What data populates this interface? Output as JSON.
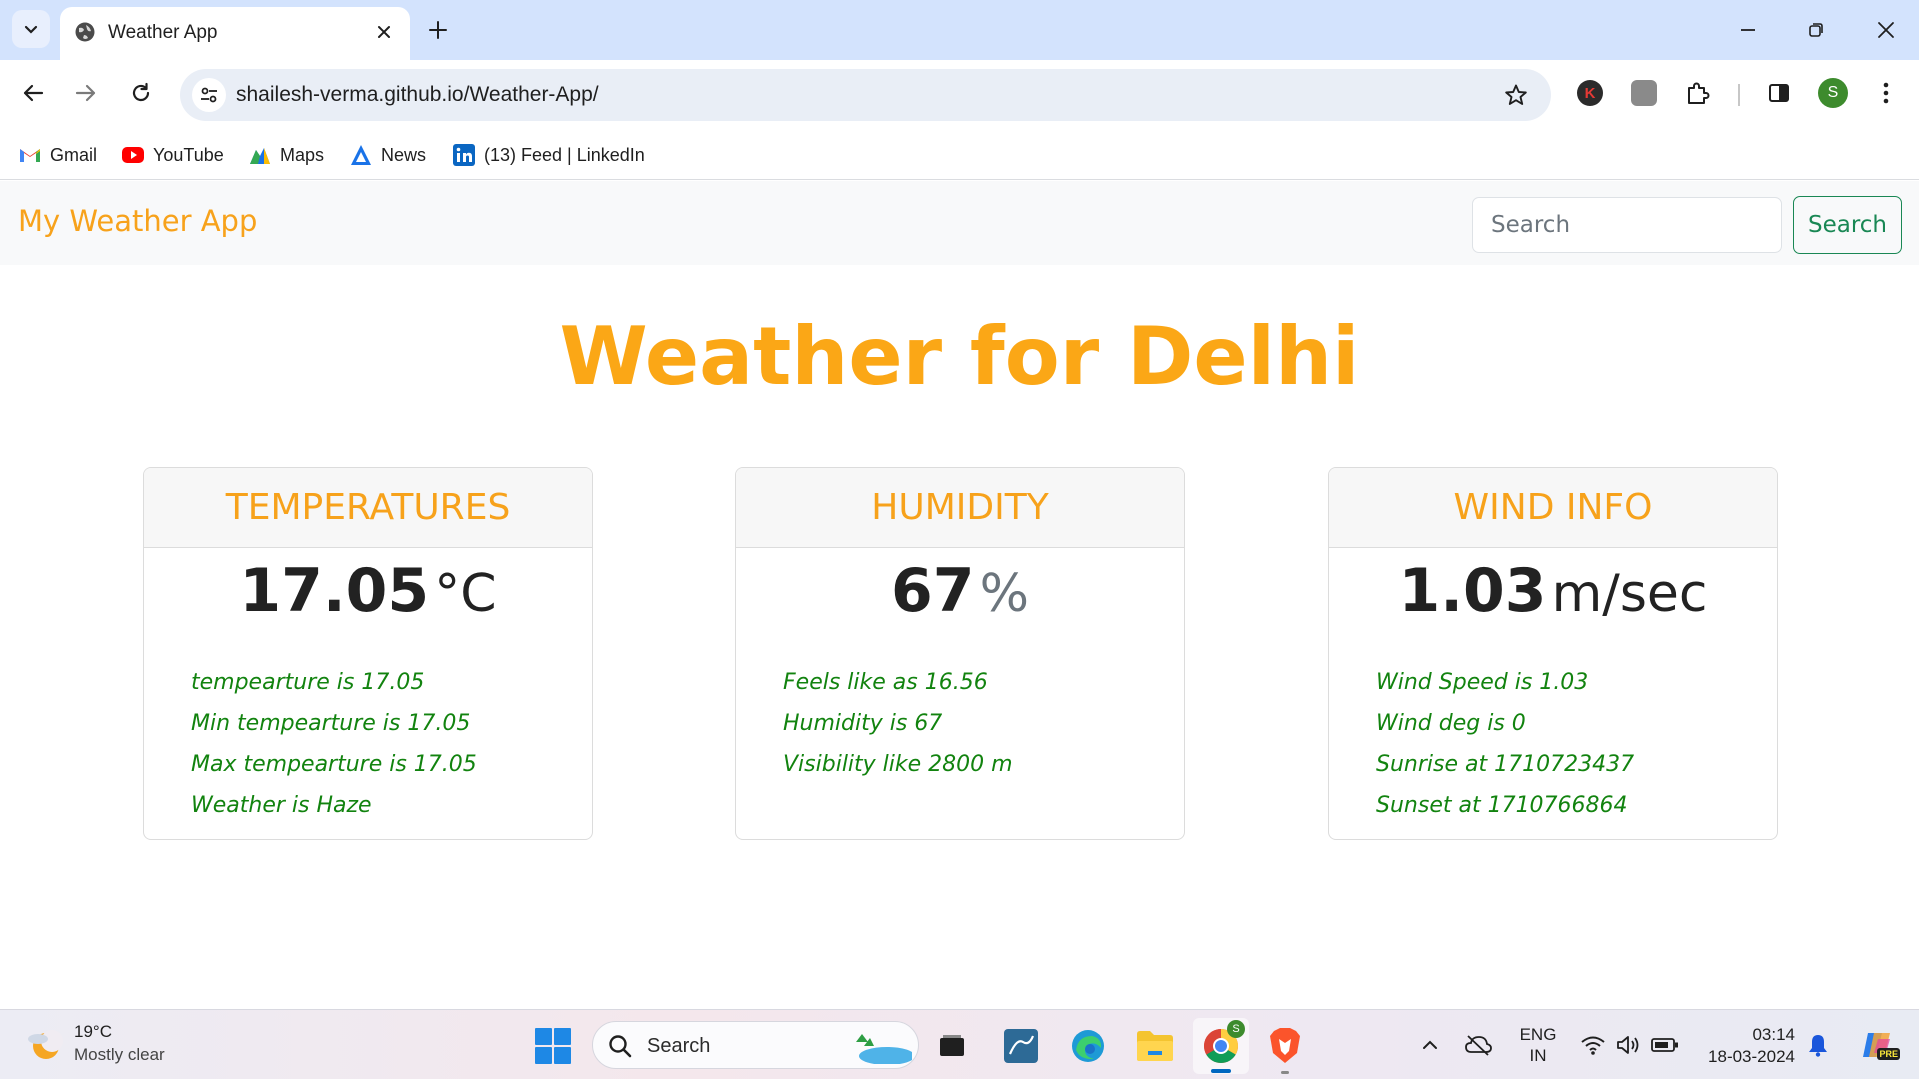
{
  "browser": {
    "tab_title": "Weather App",
    "url": "shailesh-verma.github.io/Weather-App/",
    "profile_initial": "S",
    "extension_k_label": "K",
    "bookmarks": [
      {
        "label": "Gmail",
        "icon": "gmail-icon"
      },
      {
        "label": "YouTube",
        "icon": "youtube-icon"
      },
      {
        "label": "Maps",
        "icon": "maps-icon"
      },
      {
        "label": "News",
        "icon": "news-icon"
      },
      {
        "label": "(13) Feed | LinkedIn",
        "icon": "linkedin-icon"
      }
    ]
  },
  "navbar": {
    "brand": "My Weather App",
    "search_placeholder": "Search",
    "search_button": "Search"
  },
  "main": {
    "heading": "Weather for Delhi",
    "cards": [
      {
        "title": "TEMPERATURES",
        "value": "17.05",
        "unit": "°C",
        "details": [
          "tempearture is 17.05",
          "Min tempearture is 17.05",
          "Max tempearture is 17.05",
          "Weather is Haze"
        ]
      },
      {
        "title": "HUMIDITY",
        "value": "67",
        "unit": "%",
        "details": [
          "Feels like as 16.56",
          "Humidity is 67",
          "Visibility like 2800 m"
        ]
      },
      {
        "title": "WIND INFO",
        "value": "1.03",
        "unit": "m/sec",
        "details": [
          "Wind Speed is 1.03",
          "Wind deg is 0",
          "Sunrise at 1710723437",
          "Sunset at 1710766864"
        ]
      }
    ]
  },
  "taskbar": {
    "weather_temp": "19°C",
    "weather_desc": "Mostly clear",
    "search_label": "Search",
    "lang_line1": "ENG",
    "lang_line2": "IN",
    "time": "03:14",
    "date": "18-03-2024",
    "copilot_badge": "PRE",
    "chrome_badge": "S"
  },
  "colors": {
    "accent_orange": "#f7a21b",
    "heading_orange": "#fba716",
    "detail_green": "#12830f",
    "button_green": "#198754"
  }
}
